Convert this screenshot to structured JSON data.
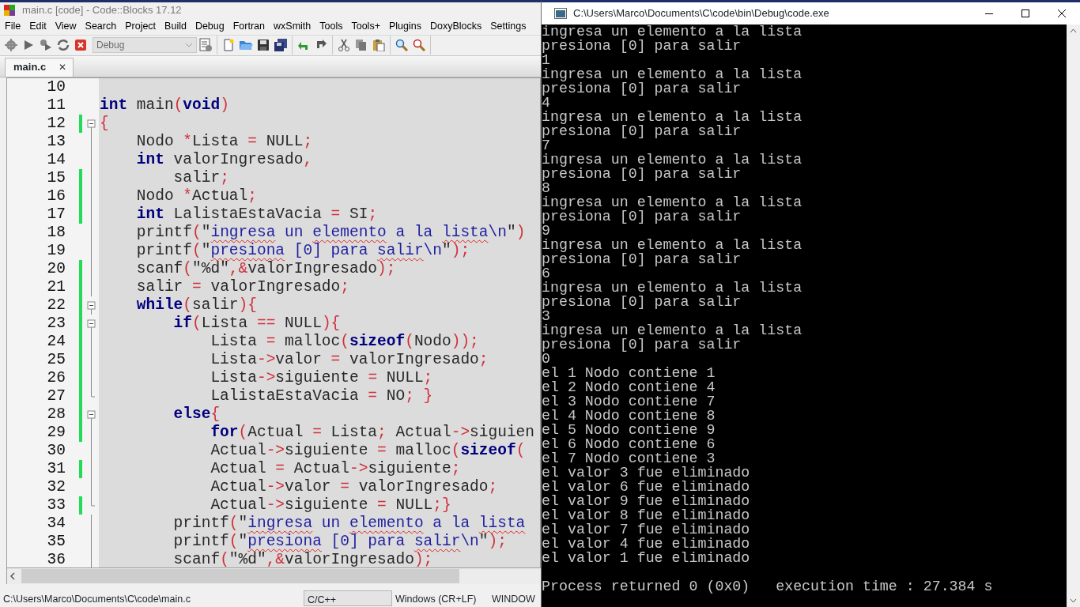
{
  "ide": {
    "title": "main.c [code] - Code::Blocks 17.12",
    "menu": [
      "File",
      "Edit",
      "View",
      "Search",
      "Project",
      "Build",
      "Debug",
      "Fortran",
      "wxSmith",
      "Tools",
      "Tools+",
      "Plugins",
      "DoxyBlocks",
      "Settings"
    ],
    "build_target": "Debug",
    "tabs": [
      {
        "label": "main.c",
        "selected": true,
        "close": "✕"
      }
    ],
    "editor": {
      "lines": [
        {
          "number": "10",
          "changed": false,
          "in_fold": false,
          "fold_start": false,
          "fold_end": false
        },
        {
          "number": "11",
          "changed": false,
          "in_fold": false,
          "fold_start": false,
          "fold_end": false,
          "tokens": [
            {
              "kind": "kw",
              "text": "int"
            },
            {
              "kind": "id",
              "text": " main"
            },
            {
              "kind": "op",
              "text": "("
            },
            {
              "kind": "kw",
              "text": "void"
            },
            {
              "kind": "op",
              "text": ")"
            }
          ]
        },
        {
          "number": "12",
          "changed": true,
          "in_fold": true,
          "fold_start": true,
          "fold_end": false,
          "tokens": [
            {
              "kind": "op",
              "text": "{"
            }
          ]
        },
        {
          "number": "13",
          "changed": false,
          "in_fold": true,
          "fold_start": false,
          "fold_end": false,
          "tokens": [
            {
              "kind": "id",
              "text": "    Nodo "
            },
            {
              "kind": "op",
              "text": "*"
            },
            {
              "kind": "id",
              "text": "Lista "
            },
            {
              "kind": "op",
              "text": "="
            },
            {
              "kind": "id",
              "text": " NULL"
            },
            {
              "kind": "op",
              "text": ";"
            }
          ]
        },
        {
          "number": "14",
          "changed": false,
          "in_fold": true,
          "fold_start": false,
          "fold_end": false,
          "tokens": [
            {
              "kind": "kw",
              "text": "    int"
            },
            {
              "kind": "id",
              "text": " valorIngresado"
            },
            {
              "kind": "op",
              "text": ","
            }
          ]
        },
        {
          "number": "15",
          "changed": true,
          "in_fold": true,
          "fold_start": false,
          "fold_end": false,
          "tokens": [
            {
              "kind": "id",
              "text": "        salir"
            },
            {
              "kind": "op",
              "text": ";"
            }
          ]
        },
        {
          "number": "16",
          "changed": true,
          "in_fold": true,
          "fold_start": false,
          "fold_end": false,
          "tokens": [
            {
              "kind": "id",
              "text": "    Nodo "
            },
            {
              "kind": "op",
              "text": "*"
            },
            {
              "kind": "id",
              "text": "Actual"
            },
            {
              "kind": "op",
              "text": ";"
            }
          ]
        },
        {
          "number": "17",
          "changed": true,
          "in_fold": true,
          "fold_start": false,
          "fold_end": false,
          "tokens": [
            {
              "kind": "kw",
              "text": "    int"
            },
            {
              "kind": "id",
              "text": " LalistaEstaVacia "
            },
            {
              "kind": "op",
              "text": "="
            },
            {
              "kind": "id",
              "text": " SI"
            },
            {
              "kind": "op",
              "text": ";"
            }
          ]
        },
        {
          "number": "18",
          "changed": false,
          "in_fold": true,
          "fold_start": false,
          "fold_end": false,
          "tokens": [
            {
              "kind": "id",
              "text": "    printf"
            },
            {
              "kind": "op",
              "text": "("
            },
            {
              "kind": "id",
              "text": "\""
            },
            {
              "kind": "spell",
              "text": "ingresa"
            },
            {
              "kind": "str",
              "text": " un "
            },
            {
              "kind": "spell",
              "text": "elemento"
            },
            {
              "kind": "str",
              "text": " a la "
            },
            {
              "kind": "spell",
              "text": "lista"
            },
            {
              "kind": "str",
              "text": "\\n"
            },
            {
              "kind": "id",
              "text": "\""
            },
            {
              "kind": "op",
              "text": ")"
            }
          ]
        },
        {
          "number": "19",
          "changed": false,
          "in_fold": true,
          "fold_start": false,
          "fold_end": false,
          "tokens": [
            {
              "kind": "id",
              "text": "    printf"
            },
            {
              "kind": "op",
              "text": "("
            },
            {
              "kind": "id",
              "text": "\""
            },
            {
              "kind": "spell",
              "text": "presiona"
            },
            {
              "kind": "str",
              "text": " [0] para "
            },
            {
              "kind": "spell",
              "text": "salir"
            },
            {
              "kind": "str",
              "text": "\\n"
            },
            {
              "kind": "id",
              "text": "\""
            },
            {
              "kind": "op",
              "text": ");"
            }
          ]
        },
        {
          "number": "20",
          "changed": true,
          "in_fold": true,
          "fold_start": false,
          "fold_end": false,
          "tokens": [
            {
              "kind": "id",
              "text": "    scanf"
            },
            {
              "kind": "op",
              "text": "("
            },
            {
              "kind": "id",
              "text": "\"%d\""
            },
            {
              "kind": "op",
              "text": ",&"
            },
            {
              "kind": "id",
              "text": "valorIngresado"
            },
            {
              "kind": "op",
              "text": ");"
            }
          ]
        },
        {
          "number": "21",
          "changed": true,
          "in_fold": true,
          "fold_start": false,
          "fold_end": false,
          "tokens": [
            {
              "kind": "id",
              "text": "    salir "
            },
            {
              "kind": "op",
              "text": "="
            },
            {
              "kind": "id",
              "text": " valorIngresado"
            },
            {
              "kind": "op",
              "text": ";"
            }
          ]
        },
        {
          "number": "22",
          "changed": true,
          "in_fold": true,
          "fold_start": true,
          "fold_end": false,
          "tokens": [
            {
              "kind": "kw",
              "text": "    while"
            },
            {
              "kind": "op",
              "text": "("
            },
            {
              "kind": "id",
              "text": "salir"
            },
            {
              "kind": "op",
              "text": "){"
            }
          ]
        },
        {
          "number": "23",
          "changed": true,
          "in_fold": true,
          "fold_start": true,
          "fold_end": false,
          "tokens": [
            {
              "kind": "kw",
              "text": "        if"
            },
            {
              "kind": "op",
              "text": "("
            },
            {
              "kind": "id",
              "text": "Lista "
            },
            {
              "kind": "op",
              "text": "=="
            },
            {
              "kind": "id",
              "text": " NULL"
            },
            {
              "kind": "op",
              "text": "){"
            }
          ]
        },
        {
          "number": "24",
          "changed": true,
          "in_fold": true,
          "fold_start": false,
          "fold_end": false,
          "tokens": [
            {
              "kind": "id",
              "text": "            Lista "
            },
            {
              "kind": "op",
              "text": "="
            },
            {
              "kind": "id",
              "text": " malloc"
            },
            {
              "kind": "op",
              "text": "("
            },
            {
              "kind": "kw",
              "text": "sizeof"
            },
            {
              "kind": "op",
              "text": "("
            },
            {
              "kind": "id",
              "text": "Nodo"
            },
            {
              "kind": "op",
              "text": "));"
            }
          ]
        },
        {
          "number": "25",
          "changed": true,
          "in_fold": true,
          "fold_start": false,
          "fold_end": false,
          "tokens": [
            {
              "kind": "id",
              "text": "            Lista"
            },
            {
              "kind": "op",
              "text": "->"
            },
            {
              "kind": "id",
              "text": "valor "
            },
            {
              "kind": "op",
              "text": "="
            },
            {
              "kind": "id",
              "text": " valorIngresado"
            },
            {
              "kind": "op",
              "text": ";"
            }
          ]
        },
        {
          "number": "26",
          "changed": true,
          "in_fold": true,
          "fold_start": false,
          "fold_end": false,
          "tokens": [
            {
              "kind": "id",
              "text": "            Lista"
            },
            {
              "kind": "op",
              "text": "->"
            },
            {
              "kind": "id",
              "text": "siguiente "
            },
            {
              "kind": "op",
              "text": "="
            },
            {
              "kind": "id",
              "text": " NULL"
            },
            {
              "kind": "op",
              "text": ";"
            }
          ]
        },
        {
          "number": "27",
          "changed": true,
          "in_fold": true,
          "fold_start": false,
          "fold_end": true,
          "tokens": [
            {
              "kind": "id",
              "text": "            LalistaEstaVacia "
            },
            {
              "kind": "op",
              "text": "="
            },
            {
              "kind": "id",
              "text": " NO"
            },
            {
              "kind": "op",
              "text": "; }"
            }
          ]
        },
        {
          "number": "28",
          "changed": true,
          "in_fold": true,
          "fold_start": true,
          "fold_end": false,
          "tokens": [
            {
              "kind": "kw",
              "text": "        else"
            },
            {
              "kind": "op",
              "text": "{"
            }
          ]
        },
        {
          "number": "29",
          "changed": true,
          "in_fold": true,
          "fold_start": false,
          "fold_end": false,
          "tokens": [
            {
              "kind": "kw",
              "text": "            for"
            },
            {
              "kind": "op",
              "text": "("
            },
            {
              "kind": "id",
              "text": "Actual "
            },
            {
              "kind": "op",
              "text": "="
            },
            {
              "kind": "id",
              "text": " Lista"
            },
            {
              "kind": "op",
              "text": ";"
            },
            {
              "kind": "id",
              "text": " Actual"
            },
            {
              "kind": "op",
              "text": "->"
            },
            {
              "kind": "id",
              "text": "siguien"
            }
          ]
        },
        {
          "number": "30",
          "changed": false,
          "in_fold": true,
          "fold_start": false,
          "fold_end": false,
          "tokens": [
            {
              "kind": "id",
              "text": "            Actual"
            },
            {
              "kind": "op",
              "text": "->"
            },
            {
              "kind": "id",
              "text": "siguiente "
            },
            {
              "kind": "op",
              "text": "="
            },
            {
              "kind": "id",
              "text": " malloc"
            },
            {
              "kind": "op",
              "text": "("
            },
            {
              "kind": "kw",
              "text": "sizeof"
            },
            {
              "kind": "op",
              "text": "("
            }
          ]
        },
        {
          "number": "31",
          "changed": true,
          "in_fold": true,
          "fold_start": false,
          "fold_end": false,
          "tokens": [
            {
              "kind": "id",
              "text": "            Actual "
            },
            {
              "kind": "op",
              "text": "="
            },
            {
              "kind": "id",
              "text": " Actual"
            },
            {
              "kind": "op",
              "text": "->"
            },
            {
              "kind": "id",
              "text": "siguiente"
            },
            {
              "kind": "op",
              "text": ";"
            }
          ]
        },
        {
          "number": "32",
          "changed": false,
          "in_fold": true,
          "fold_start": false,
          "fold_end": false,
          "tokens": [
            {
              "kind": "id",
              "text": "            Actual"
            },
            {
              "kind": "op",
              "text": "->"
            },
            {
              "kind": "id",
              "text": "valor "
            },
            {
              "kind": "op",
              "text": "="
            },
            {
              "kind": "id",
              "text": " valorIngresado"
            },
            {
              "kind": "op",
              "text": ";"
            }
          ]
        },
        {
          "number": "33",
          "changed": true,
          "in_fold": true,
          "fold_start": false,
          "fold_end": true,
          "tokens": [
            {
              "kind": "id",
              "text": "            Actual"
            },
            {
              "kind": "op",
              "text": "->"
            },
            {
              "kind": "id",
              "text": "siguiente "
            },
            {
              "kind": "op",
              "text": "="
            },
            {
              "kind": "id",
              "text": " NULL"
            },
            {
              "kind": "op",
              "text": ";}"
            }
          ]
        },
        {
          "number": "34",
          "changed": false,
          "in_fold": true,
          "fold_start": false,
          "fold_end": false,
          "tokens": [
            {
              "kind": "id",
              "text": "        printf"
            },
            {
              "kind": "op",
              "text": "("
            },
            {
              "kind": "id",
              "text": "\""
            },
            {
              "kind": "spell",
              "text": "ingresa"
            },
            {
              "kind": "str",
              "text": " un "
            },
            {
              "kind": "spell",
              "text": "elemento"
            },
            {
              "kind": "str",
              "text": " a la "
            },
            {
              "kind": "spell",
              "text": "lista"
            }
          ]
        },
        {
          "number": "35",
          "changed": false,
          "in_fold": true,
          "fold_start": false,
          "fold_end": false,
          "tokens": [
            {
              "kind": "id",
              "text": "        printf"
            },
            {
              "kind": "op",
              "text": "("
            },
            {
              "kind": "id",
              "text": "\""
            },
            {
              "kind": "spell",
              "text": "presiona"
            },
            {
              "kind": "str",
              "text": " [0] para "
            },
            {
              "kind": "spell",
              "text": "salir"
            },
            {
              "kind": "str",
              "text": "\\n"
            },
            {
              "kind": "id",
              "text": "\""
            },
            {
              "kind": "op",
              "text": ");"
            }
          ]
        },
        {
          "number": "36",
          "changed": false,
          "in_fold": true,
          "fold_start": false,
          "fold_end": false,
          "tokens": [
            {
              "kind": "id",
              "text": "        scanf"
            },
            {
              "kind": "op",
              "text": "("
            },
            {
              "kind": "id",
              "text": "\"%d\""
            },
            {
              "kind": "op",
              "text": ",&"
            },
            {
              "kind": "id",
              "text": "valorIngresado"
            },
            {
              "kind": "op",
              "text": ");"
            }
          ]
        }
      ]
    },
    "status_bar": [
      "C:\\Users\\Marco\\Documents\\C\\code\\main.c",
      "C/C++",
      "Windows (CR+LF)",
      "WINDOW"
    ]
  },
  "console": {
    "title": "C:\\Users\\Marco\\Documents\\C\\code\\bin\\Debug\\code.exe",
    "output": [
      "ingresa un elemento a la lista",
      "presiona [0] para salir",
      "1",
      "ingresa un elemento a la lista",
      "presiona [0] para salir",
      "4",
      "ingresa un elemento a la lista",
      "presiona [0] para salir",
      "7",
      "ingresa un elemento a la lista",
      "presiona [0] para salir",
      "8",
      "ingresa un elemento a la lista",
      "presiona [0] para salir",
      "9",
      "ingresa un elemento a la lista",
      "presiona [0] para salir",
      "6",
      "ingresa un elemento a la lista",
      "presiona [0] para salir",
      "3",
      "ingresa un elemento a la lista",
      "presiona [0] para salir",
      "0",
      "el 1 Nodo contiene 1",
      "el 2 Nodo contiene 4",
      "el 3 Nodo contiene 7",
      "el 4 Nodo contiene 8",
      "el 5 Nodo contiene 9",
      "el 6 Nodo contiene 6",
      "el 7 Nodo contiene 3",
      "el valor 3 fue eliminado",
      "el valor 6 fue eliminado",
      "el valor 9 fue eliminado",
      "el valor 8 fue eliminado",
      "el valor 7 fue eliminado",
      "el valor 4 fue eliminado",
      "el valor 1 fue eliminado"
    ],
    "summary": "Process returned 0 (0x0)   execution time : 27.384 s"
  }
}
